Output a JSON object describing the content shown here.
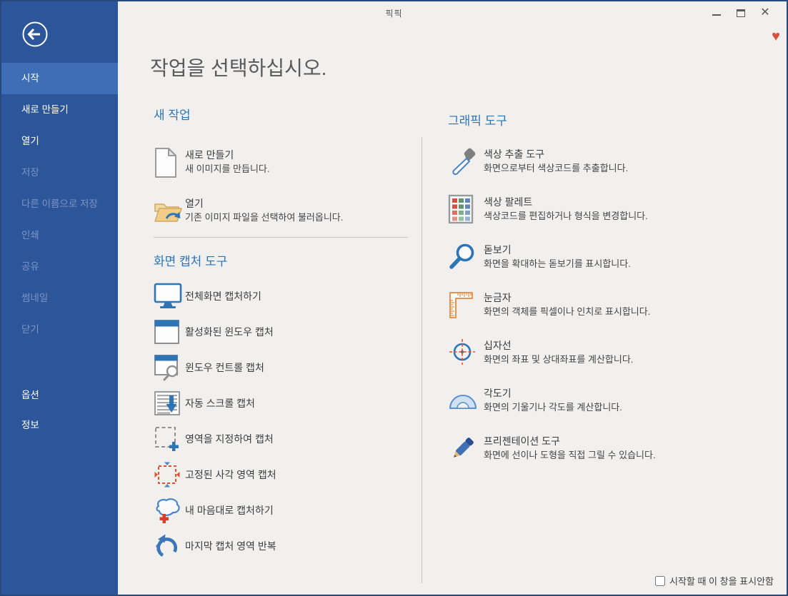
{
  "window": {
    "title": "픽픽",
    "controls": {
      "minimize": "minimize",
      "maximize": "maximize",
      "close_glyph": "✕"
    },
    "heart_glyph": "♥"
  },
  "colors": {
    "window_border": "#26497e",
    "sidebar_bg": "#2c5699",
    "sidebar_selected": "#3e6eb5",
    "sidebar_disabled_text": "#7d95c5",
    "content_bg": "#f1f0ef",
    "section_header_blue": "#2e75b6",
    "heading_gray": "#595959",
    "item_text": "#3c3c3c",
    "heart_red": "#d9513c",
    "icon_blue": "#2e75b6",
    "icon_orange": "#e8944e",
    "icon_red": "#e0502f"
  },
  "sidebar": {
    "items": [
      {
        "label": "시작",
        "state": "selected"
      },
      {
        "label": "새로 만들기",
        "state": "enabled"
      },
      {
        "label": "열기",
        "state": "enabled"
      },
      {
        "label": "저장",
        "state": "disabled"
      },
      {
        "label": "다른 이름으로 저장",
        "state": "disabled"
      },
      {
        "label": "인쇄",
        "state": "disabled"
      },
      {
        "label": "공유",
        "state": "disabled"
      },
      {
        "label": "썸네일",
        "state": "disabled"
      },
      {
        "label": "닫기",
        "state": "disabled"
      }
    ],
    "bottom_items": [
      {
        "label": "옵션"
      },
      {
        "label": "정보"
      }
    ]
  },
  "main": {
    "heading": "작업을 선택하십시오.",
    "sections": {
      "new_task": {
        "header": "새 작업",
        "items": [
          {
            "icon": "new-document-icon",
            "title": "새로 만들기",
            "desc": "새 이미지를 만듭니다."
          },
          {
            "icon": "open-folder-icon",
            "title": "열기",
            "desc": "기존 이미지 파일을 선택하여 불러옵니다."
          }
        ]
      },
      "capture_tools": {
        "header": "화면 캡처 도구",
        "items": [
          {
            "icon": "fullscreen-capture-icon",
            "title": "전체화면 캡처하기"
          },
          {
            "icon": "active-window-capture-icon",
            "title": "활성화된 윈도우 캡처"
          },
          {
            "icon": "window-control-capture-icon",
            "title": "윈도우 컨트롤 캡처"
          },
          {
            "icon": "scrolling-capture-icon",
            "title": "자동 스크롤 캡처"
          },
          {
            "icon": "region-capture-icon",
            "title": "영역을 지정하여 캡처"
          },
          {
            "icon": "fixed-region-capture-icon",
            "title": "고정된 사각 영역 캡처"
          },
          {
            "icon": "freehand-capture-icon",
            "title": "내 마음대로 캡처하기"
          },
          {
            "icon": "repeat-last-capture-icon",
            "title": "마지막 캡처 영역 반복"
          }
        ]
      },
      "graphic_tools": {
        "header": "그래픽 도구",
        "items": [
          {
            "icon": "color-picker-icon",
            "title": "색상 추출 도구",
            "desc": "화면으로부터 색상코드를 추출합니다."
          },
          {
            "icon": "color-palette-icon",
            "title": "색상 팔레트",
            "desc": "색상코드를 편집하거나 형식을 변경합니다."
          },
          {
            "icon": "magnifier-icon",
            "title": "돋보기",
            "desc": "화면을 확대하는 돋보기를 표시합니다."
          },
          {
            "icon": "ruler-icon",
            "title": "눈금자",
            "desc": "화면의 객체를 픽셀이나 인치로 표시합니다."
          },
          {
            "icon": "crosshair-icon",
            "title": "십자선",
            "desc": "화면의 좌표 및 상대좌표를 계산합니다."
          },
          {
            "icon": "protractor-icon",
            "title": "각도기",
            "desc": "화면의 기울기나 각도를 계산합니다."
          },
          {
            "icon": "presentation-pen-icon",
            "title": "프리젠테이션 도구",
            "desc": "화면에 선이나 도형을 직접 그릴 수 있습니다."
          }
        ]
      }
    },
    "footer": {
      "checkbox_label": "시작할 때 이 창을 표시안함",
      "checkbox_checked": false
    }
  }
}
